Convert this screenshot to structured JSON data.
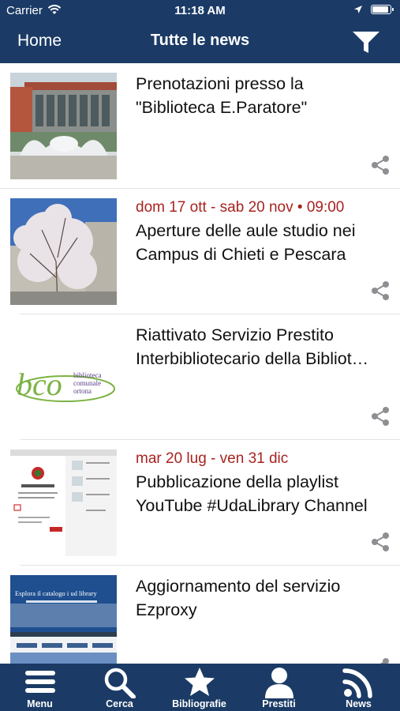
{
  "status_bar": {
    "carrier": "Carrier",
    "time": "11:18 AM",
    "battery_level": 1.0
  },
  "nav": {
    "back_label": "Home",
    "title": "Tutte le news",
    "filter_icon": "filter-icon"
  },
  "news": [
    {
      "date": "",
      "title_lines": [
        "Prenotazioni presso la",
        "\"Biblioteca E.Paratore\""
      ]
    },
    {
      "date": "dom 17 ott - sab 20 nov • 09:00",
      "title_lines": [
        "Aperture delle aule studio nei",
        "Campus di Chieti e Pescara"
      ]
    },
    {
      "date": "",
      "title_lines": [
        "Riattivato Servizio Prestito",
        "Interbibliotecario della Bibliot…"
      ],
      "logo": {
        "mark": "bco",
        "line1": "biblioteca",
        "line2": "comunale",
        "line3": "ortona"
      }
    },
    {
      "date": "mar 20 lug - ven 31 dic",
      "title_lines": [
        "Pubblicazione della playlist",
        "YouTube #UdaLibrary Channel"
      ]
    },
    {
      "date": "",
      "title_lines": [
        "Aggiornamento del servizio",
        "Ezproxy"
      ],
      "thumb_text": "Esplora il catalogo i ud library"
    }
  ],
  "tabs": [
    {
      "label": "Menu",
      "icon": "menu-icon"
    },
    {
      "label": "Cerca",
      "icon": "search-icon"
    },
    {
      "label": "Bibliografie",
      "icon": "star-icon"
    },
    {
      "label": "Prestiti",
      "icon": "user-icon"
    },
    {
      "label": "News",
      "icon": "rss-icon"
    }
  ],
  "colors": {
    "bar": "#1b3b66",
    "date": "#a8231f"
  }
}
